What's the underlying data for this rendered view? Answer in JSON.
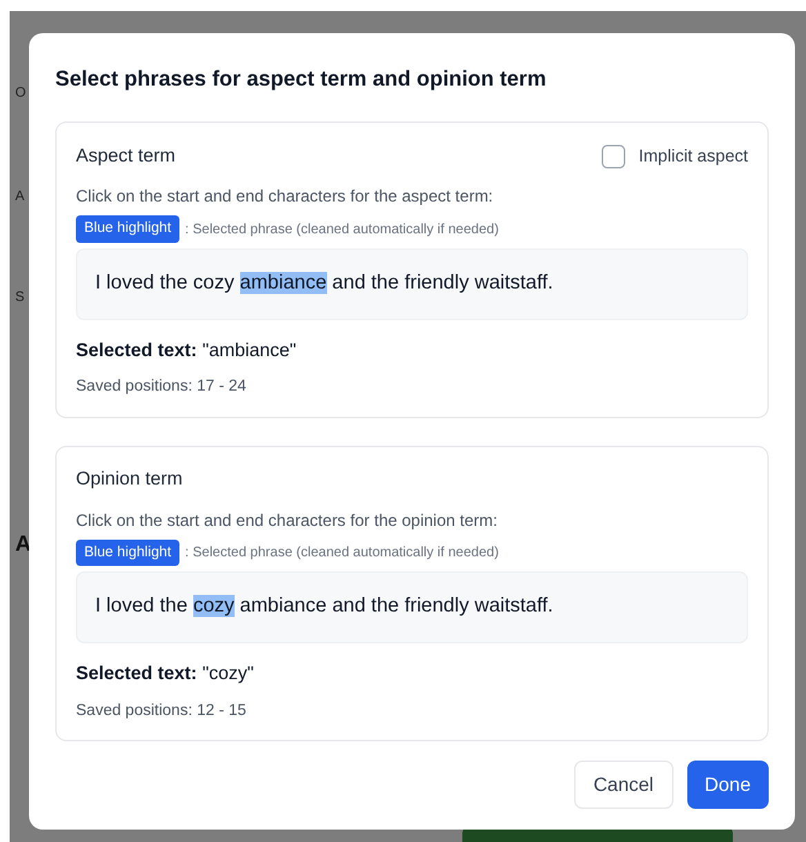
{
  "background": {
    "labels": [
      {
        "text": "O",
        "kind": "label"
      },
      {
        "text": "A",
        "kind": "label"
      },
      {
        "text": "S",
        "kind": "label"
      },
      {
        "text": "A",
        "kind": "heading"
      }
    ]
  },
  "dialog": {
    "title": "Select phrases for aspect term and opinion term",
    "sections": [
      {
        "title": "Aspect term",
        "implicit": {
          "label": "Implicit aspect",
          "checked": false
        },
        "instruction": "Click on the start and end characters for the aspect term:",
        "legend_badge": "Blue highlight",
        "legend_text": ": Selected phrase (cleaned automatically if needed)",
        "sentence": {
          "before": "I loved the cozy ",
          "highlight": "ambiance",
          "after": " and the friendly waitstaff."
        },
        "selected_label": "Selected text:",
        "selected_value": "\"ambiance\"",
        "positions": "Saved positions: 17 - 24"
      },
      {
        "title": "Opinion term",
        "instruction": "Click on the start and end characters for the opinion term:",
        "legend_badge": "Blue highlight",
        "legend_text": ": Selected phrase (cleaned automatically if needed)",
        "sentence": {
          "before": "I loved the ",
          "highlight": "cozy",
          "after": " ambiance and the friendly waitstaff."
        },
        "selected_label": "Selected text:",
        "selected_value": "\"cozy\"",
        "positions": "Saved positions: 12 - 15"
      }
    ],
    "buttons": [
      {
        "label": "Cancel",
        "kind": "secondary"
      },
      {
        "label": "Done",
        "kind": "primary"
      }
    ]
  }
}
